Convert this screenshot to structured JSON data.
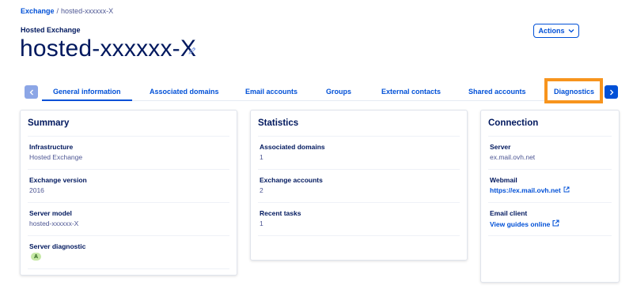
{
  "breadcrumb": {
    "root": "Exchange",
    "separator": "/",
    "current": "hosted-xxxxxx-X"
  },
  "header": {
    "subtitle": "Hosted Exchange",
    "title": "hosted-xxxxxx-X",
    "actions_label": "Actions"
  },
  "tabs": [
    {
      "label": "General information",
      "active": true
    },
    {
      "label": "Associated domains"
    },
    {
      "label": "Email accounts"
    },
    {
      "label": "Groups"
    },
    {
      "label": "External contacts"
    },
    {
      "label": "Shared accounts"
    },
    {
      "label": "Diagnostics",
      "highlighted": true
    }
  ],
  "summary": {
    "title": "Summary",
    "infrastructure_label": "Infrastructure",
    "infrastructure_value": "Hosted Exchange",
    "version_label": "Exchange version",
    "version_value": "2016",
    "model_label": "Server model",
    "model_value": "hosted-xxxxxx-X",
    "diagnostic_label": "Server diagnostic",
    "diagnostic_value": "A"
  },
  "statistics": {
    "title": "Statistics",
    "domains_label": "Associated domains",
    "domains_value": "1",
    "accounts_label": "Exchange accounts",
    "accounts_value": "2",
    "tasks_label": "Recent tasks",
    "tasks_value": "1"
  },
  "connection": {
    "title": "Connection",
    "server_label": "Server",
    "server_value": "ex.mail.ovh.net",
    "webmail_label": "Webmail",
    "webmail_link": "https://ex.mail.ovh.net",
    "client_label": "Email client",
    "client_link": "View guides online"
  },
  "colors": {
    "primary": "#0050d7",
    "text_dark": "#00185e",
    "text_muted": "#4d5693",
    "highlight": "#f7941d",
    "badge_green": "#c6e8a6"
  }
}
